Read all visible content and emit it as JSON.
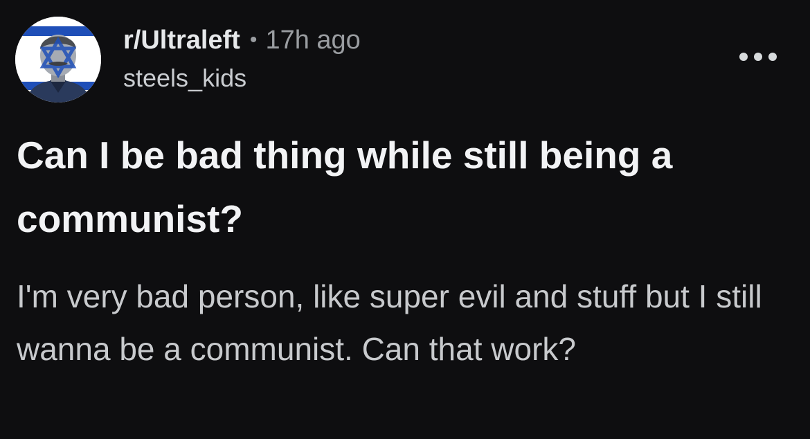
{
  "post": {
    "subreddit": "r/Ultraleft",
    "separator": "•",
    "timestamp": "17h ago",
    "username": "steels_kids",
    "title": "Can I be bad thing while still being a communist?",
    "body": "I'm very bad person, like super evil and stuff but I still wanna be a communist. Can that work?",
    "avatar_icon": "subreddit-avatar-icon",
    "more_icon": "more-options-icon"
  },
  "colors": {
    "background": "#0e0e10",
    "title_text": "#f2f3f5",
    "body_text": "#c8cacd",
    "muted_text": "#9a9da1",
    "avatar_flag_blue": "#1f4fb8"
  }
}
